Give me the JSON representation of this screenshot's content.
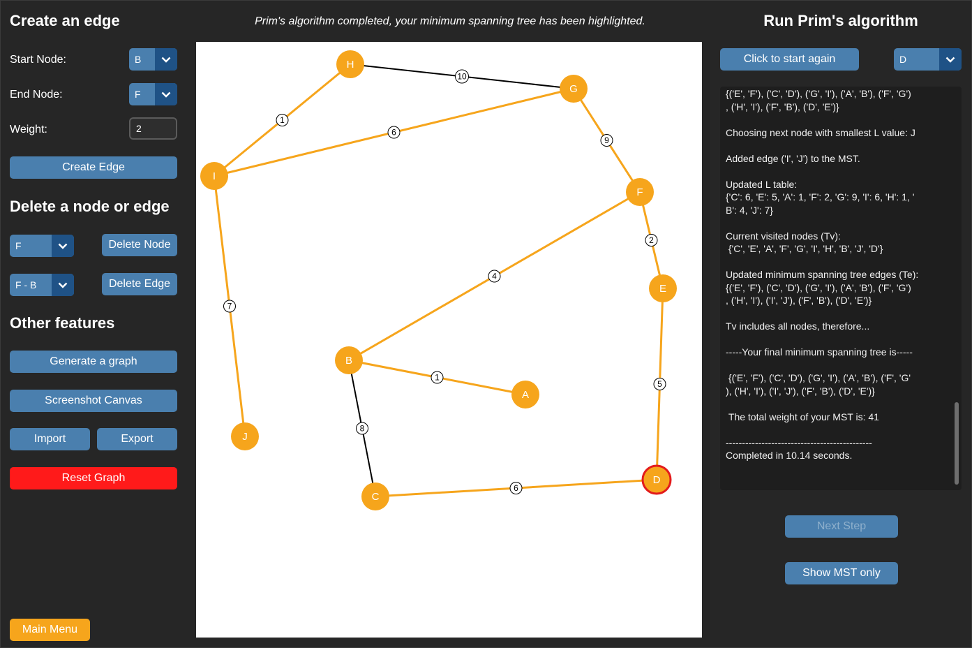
{
  "left_panel": {
    "create_edge_title": "Create an edge",
    "start_node_label": "Start Node:",
    "start_node_value": "B",
    "end_node_label": "End Node:",
    "end_node_value": "F",
    "weight_label": "Weight:",
    "weight_value": "2",
    "create_edge_button": "Create Edge",
    "delete_title": "Delete a node or edge",
    "delete_node_select": "F",
    "delete_node_button": "Delete Node",
    "delete_edge_select": "F - B",
    "delete_edge_button": "Delete Edge",
    "other_title": "Other features",
    "generate_button": "Generate a graph",
    "screenshot_button": "Screenshot Canvas",
    "import_button": "Import",
    "export_button": "Export",
    "reset_button": "Reset Graph",
    "main_menu_button": "Main Menu"
  },
  "status_message": "Prim's algorithm completed, your minimum spanning tree has been highlighted.",
  "right_panel": {
    "title": "Run Prim's algorithm",
    "start_again_button": "Click to start again",
    "start_node_select": "D",
    "log": [
      "{('E', 'F'), ('C', 'D'), ('G', 'I'), ('A', 'B'), ('F', 'G')\n, ('H', 'I'), ('F', 'B'), ('D', 'E')}",
      "Choosing next node with smallest L value: J",
      "Added edge ('I', 'J') to the MST.",
      "Updated L table:\n{'C': 6, 'E': 5, 'A': 1, 'F': 2, 'G': 9, 'I': 6, 'H': 1, '\nB': 4, 'J': 7}",
      "Current visited nodes (Tv):\n {'C', 'E', 'A', 'F', 'G', 'I', 'H', 'B', 'J', 'D'}",
      "Updated minimum spanning tree edges (Te):\n{('E', 'F'), ('C', 'D'), ('G', 'I'), ('A', 'B'), ('F', 'G')\n, ('H', 'I'), ('I', 'J'), ('F', 'B'), ('D', 'E')}",
      "Tv includes all nodes, therefore...",
      "-----Your final minimum spanning tree is-----",
      " {('E', 'F'), ('C', 'D'), ('G', 'I'), ('A', 'B'), ('F', 'G'\n), ('H', 'I'), ('I', 'J'), ('F', 'B'), ('D', 'E')}",
      " The total weight of your MST is: 41",
      "---------------------------------------------\nCompleted in 10.14 seconds."
    ],
    "next_step_button": "Next Step",
    "show_mst_button": "Show MST only"
  },
  "graph": {
    "colors": {
      "node": "#f6a51c",
      "mst_edge": "#f6a51c",
      "non_mst_edge": "#000000",
      "start_node_ring": "#e31b1b"
    },
    "nodes": [
      {
        "id": "H",
        "label": "H"
      },
      {
        "id": "G",
        "label": "G"
      },
      {
        "id": "I",
        "label": "I"
      },
      {
        "id": "F",
        "label": "F"
      },
      {
        "id": "E",
        "label": "E"
      },
      {
        "id": "B",
        "label": "B"
      },
      {
        "id": "A",
        "label": "A"
      },
      {
        "id": "J",
        "label": "J"
      },
      {
        "id": "C",
        "label": "C"
      },
      {
        "id": "D",
        "label": "D",
        "start": true
      }
    ],
    "edges": [
      {
        "from": "H",
        "to": "G",
        "weight": "10",
        "mst": false
      },
      {
        "from": "H",
        "to": "I",
        "weight": "1",
        "mst": true
      },
      {
        "from": "I",
        "to": "G",
        "weight": "6",
        "mst": true
      },
      {
        "from": "G",
        "to": "F",
        "weight": "9",
        "mst": true
      },
      {
        "from": "F",
        "to": "E",
        "weight": "2",
        "mst": true
      },
      {
        "from": "F",
        "to": "B",
        "weight": "4",
        "mst": true
      },
      {
        "from": "I",
        "to": "J",
        "weight": "7",
        "mst": true
      },
      {
        "from": "B",
        "to": "A",
        "weight": "1",
        "mst": true
      },
      {
        "from": "B",
        "to": "C",
        "weight": "8",
        "mst": false
      },
      {
        "from": "E",
        "to": "D",
        "weight": "5",
        "mst": true
      },
      {
        "from": "C",
        "to": "D",
        "weight": "6",
        "mst": true
      }
    ]
  }
}
